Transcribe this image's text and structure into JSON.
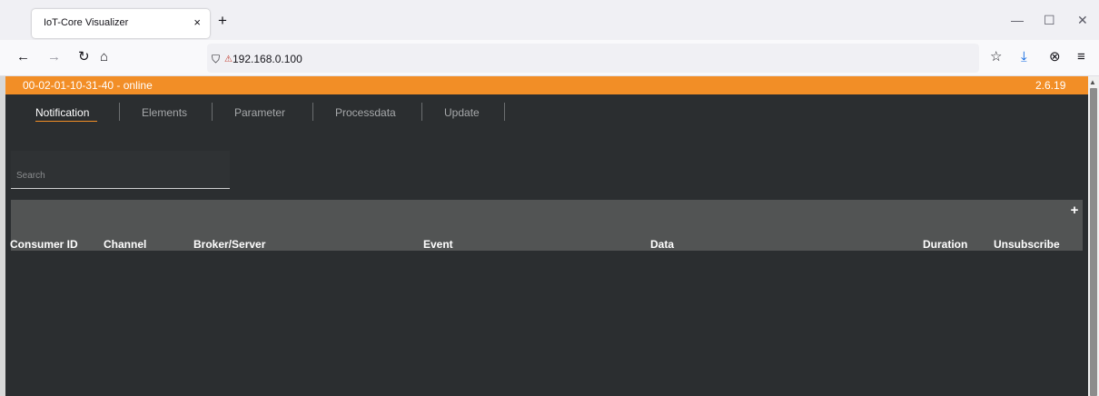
{
  "browser": {
    "tab_title": "IoT-Core Visualizer",
    "tab_close": "×",
    "new_tab": "+",
    "url": "192.168.0.100",
    "window": {
      "minimize": "—",
      "maximize": "☐",
      "close": "✕"
    },
    "nav": {
      "back": "←",
      "forward": "→",
      "reload": "↻",
      "home": "⌂"
    },
    "icons": {
      "shield": "⛉",
      "lock": "🔒",
      "star": "☆",
      "download": "⤓",
      "extension": "⊗",
      "menu": "≡"
    }
  },
  "app": {
    "status": "00-02-01-10-31-40 - online",
    "version": "2.6.19",
    "tabs": [
      {
        "label": "Notification",
        "active": true
      },
      {
        "label": "Elements"
      },
      {
        "label": "Parameter"
      },
      {
        "label": "Processdata"
      },
      {
        "label": "Update"
      }
    ],
    "search": {
      "placeholder": "Search",
      "value": ""
    },
    "add_button": "+",
    "table": {
      "columns": [
        "Consumer ID",
        "Channel",
        "Broker/Server",
        "Event",
        "Data",
        "Duration",
        "Unsubscribe"
      ]
    },
    "colors": {
      "accent": "#f28e26",
      "background": "#2b2e30",
      "header": "#525454"
    }
  }
}
